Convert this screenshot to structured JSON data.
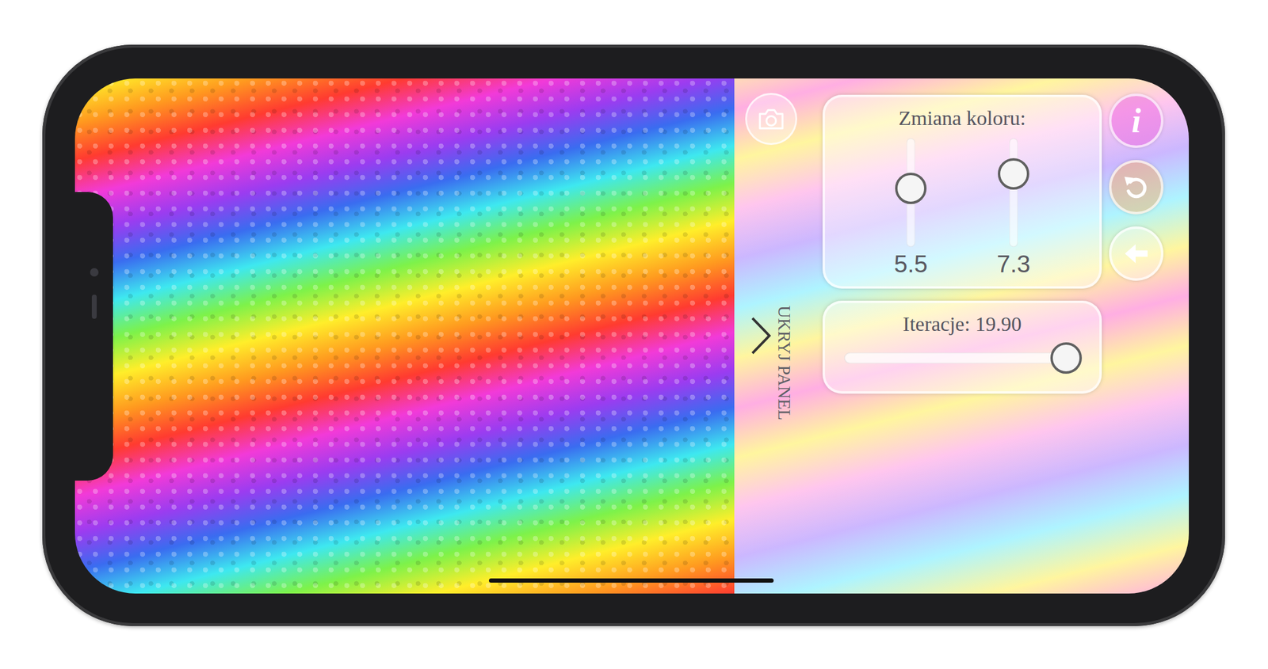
{
  "hide_panel": {
    "label": "UKRYJ PANEL"
  },
  "color_panel": {
    "title": "Zmiana koloru:",
    "sliders": [
      {
        "value": "5.5",
        "level": 0.54
      },
      {
        "value": "7.3",
        "level": 0.67
      }
    ]
  },
  "iterations": {
    "label": "Iteracje: 19.90",
    "level": 0.94
  },
  "info_button": {
    "label": "i"
  }
}
